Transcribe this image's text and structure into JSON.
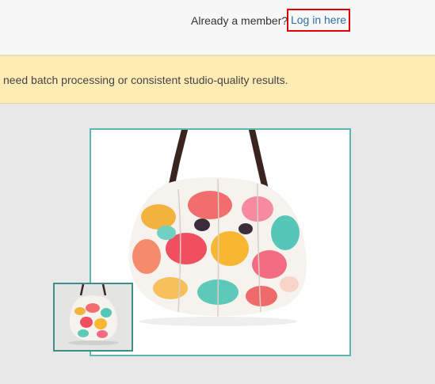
{
  "header": {
    "member_prompt": "Already a member?",
    "login_label": "Log in here"
  },
  "notice": {
    "text": "need batch processing or consistent studio-quality results."
  },
  "preview": {
    "main_image_alt": "Floral fabric hobo handbag on white background",
    "thumbnail_alt": "Original handbag photo thumbnail"
  },
  "colors": {
    "link": "#2f6fa8",
    "highlight_border": "#e00000",
    "notice_bg": "#ffecb5",
    "image_border": "#5cb8ae"
  }
}
